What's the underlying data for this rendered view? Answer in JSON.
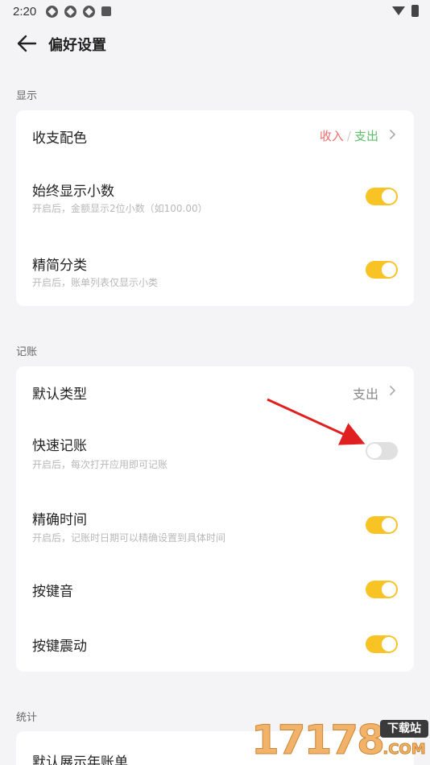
{
  "status_bar": {
    "time": "2:20"
  },
  "header": {
    "title": "偏好设置"
  },
  "sections": {
    "display": {
      "label": "显示",
      "color_scheme": {
        "title": "收支配色",
        "income": "收入",
        "slash": "/",
        "expense": "支出"
      },
      "show_decimals": {
        "title": "始终显示小数",
        "subtitle": "开启后，金额显示2位小数（如100.00）",
        "enabled": true
      },
      "simple_category": {
        "title": "精简分类",
        "subtitle": "开启后，账单列表仅显示小类",
        "enabled": true
      }
    },
    "bookkeeping": {
      "label": "记账",
      "default_type": {
        "title": "默认类型",
        "value": "支出"
      },
      "quick_entry": {
        "title": "快速记账",
        "subtitle": "开启后，每次打开应用即可记账",
        "enabled": false
      },
      "precise_time": {
        "title": "精确时间",
        "subtitle": "开启后，记账时日期可以精确设置到具体时间",
        "enabled": true
      },
      "key_sound": {
        "title": "按键音",
        "enabled": true
      },
      "key_vibrate": {
        "title": "按键震动",
        "enabled": true
      }
    },
    "stats": {
      "label": "统计",
      "default_year_bill": {
        "title": "默认展示年账单"
      }
    }
  },
  "watermark": {
    "number": "17178",
    "badge": "下载站",
    "suffix": ".COM"
  },
  "colors": {
    "toggle_on": "#f7c325",
    "toggle_off": "#e0e0e0",
    "income": "#ef6d6d",
    "expense": "#5fbf6b",
    "annotation_arrow": "#e02020"
  }
}
